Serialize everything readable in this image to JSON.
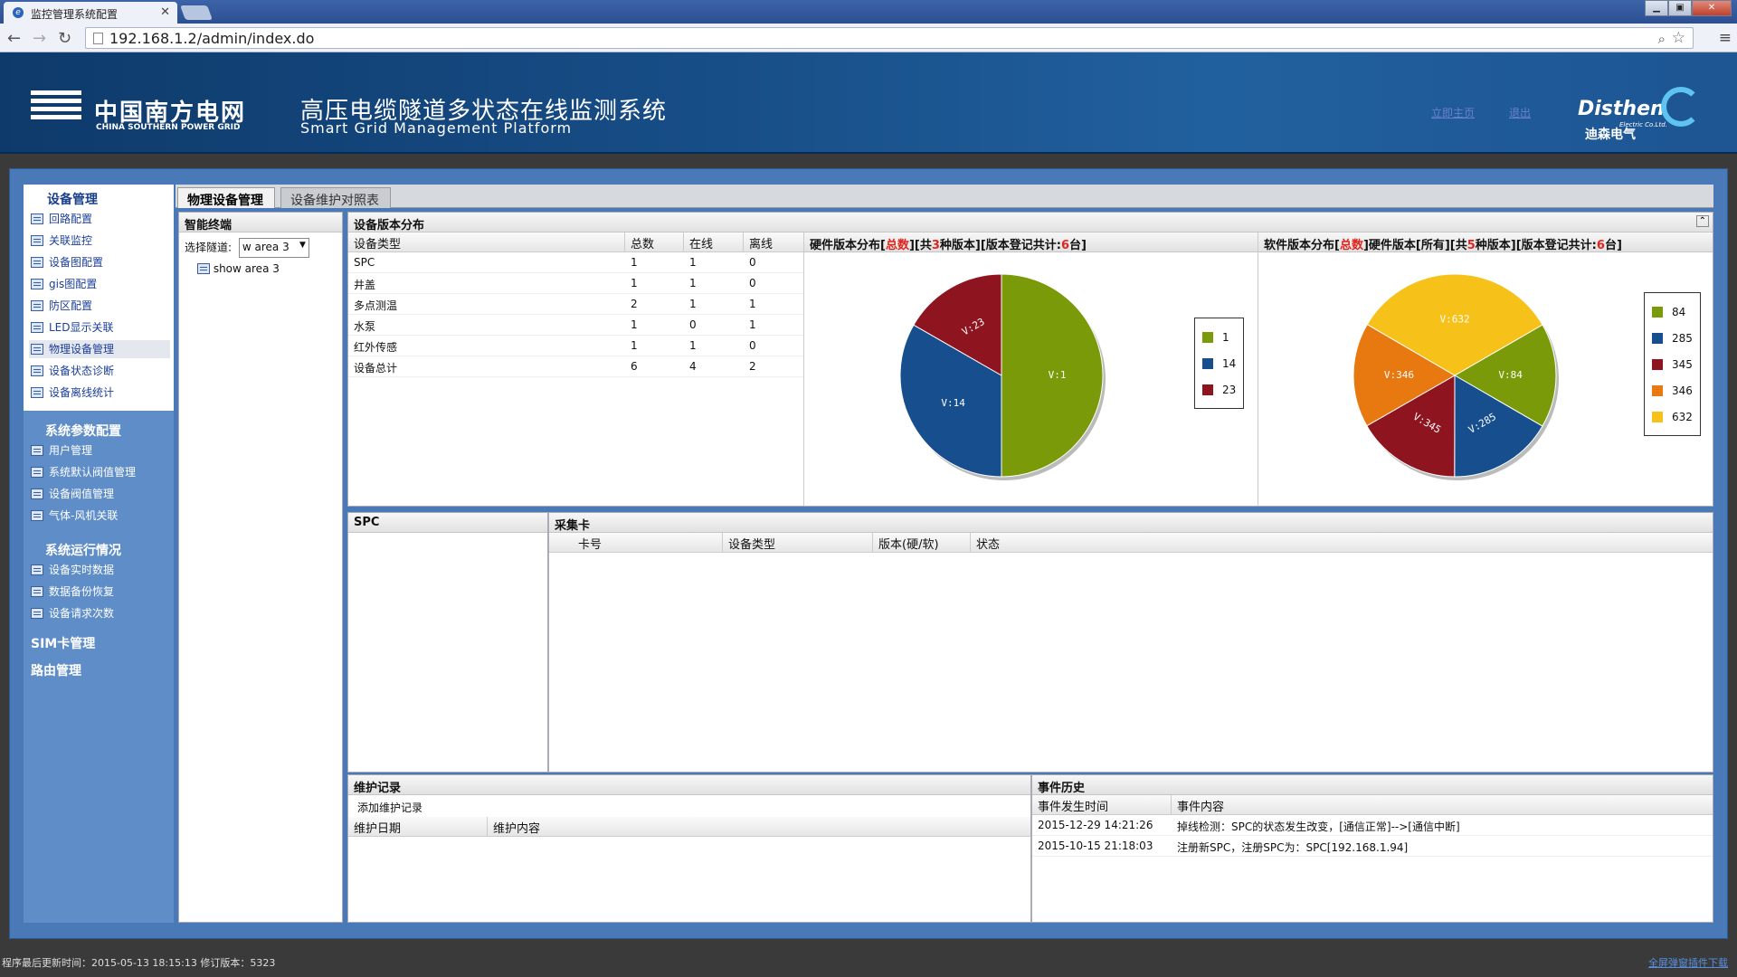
{
  "browser": {
    "tab_title": "监控管理系统配置",
    "url": "192.168.1.2/admin/index.do"
  },
  "header": {
    "logo_cn": "中国南方电网",
    "logo_en": "CHINA SOUTHERN POWER GRID",
    "title": "高压电缆隧道多状态在线监测系统",
    "subtitle": "Smart Grid Management Platform",
    "link_home": "立即主页",
    "link_logout": "退出",
    "brand_name": "Disthen",
    "brand_sub": "Electric Co.Ltd.",
    "brand_cn": "迪森电气"
  },
  "sidebar": {
    "group1": {
      "title": "设备管理",
      "items": [
        "回路配置",
        "关联监控",
        "设备图配置",
        "gis图配置",
        "防区配置",
        "LED显示关联",
        "物理设备管理",
        "设备状态诊断",
        "设备离线统计"
      ]
    },
    "group2": {
      "title": "系统参数配置",
      "items": [
        "用户管理",
        "系统默认阀值管理",
        "设备阀值管理",
        "气体-风机关联"
      ]
    },
    "group3": {
      "title": "系统运行情况",
      "items": [
        "设备实时数据",
        "数据备份恢复",
        "设备请求次数"
      ]
    },
    "group4_title": "SIM卡管理",
    "group5_title": "路由管理"
  },
  "tabs": [
    "物理设备管理",
    "设备维护对照表"
  ],
  "terminal": {
    "title": "智能终端",
    "select_label": "选择隧道:",
    "select_value": "w area 3",
    "tree_node": "show area 3"
  },
  "version": {
    "title": "设备版本分布",
    "columns": [
      "设备类型",
      "总数",
      "在线",
      "离线"
    ],
    "rows": [
      [
        "SPC",
        "1",
        "1",
        "0"
      ],
      [
        "井盖",
        "1",
        "1",
        "0"
      ],
      [
        "多点测温",
        "2",
        "1",
        "1"
      ],
      [
        "水泵",
        "1",
        "0",
        "1"
      ],
      [
        "红外传感",
        "1",
        "1",
        "0"
      ],
      [
        "设备总计",
        "6",
        "4",
        "2"
      ]
    ]
  },
  "hw_chart": {
    "t1": "硬件版本分布[",
    "t2": "总数",
    "t3": "][共",
    "t4": "3",
    "t5": "种版本][版本登记共计:",
    "t6": "6",
    "t7": "台]",
    "slice_labels": [
      "V:1",
      "V:14",
      "V:23"
    ],
    "legend": [
      "1",
      "14",
      "23"
    ],
    "colors": [
      "#7a9a0a",
      "#174f8e",
      "#8e1520"
    ]
  },
  "sw_chart": {
    "t1": "软件版本分布[",
    "t2": "总数",
    "t3": "]硬件版本[所有][共",
    "t4": "5",
    "t5": "种版本][版本登记共计:",
    "t6": "6",
    "t7": "台]",
    "slice_labels": [
      "V:84",
      "V:285",
      "V:345",
      "V:346",
      "V:632"
    ],
    "legend": [
      "84",
      "285",
      "345",
      "346",
      "632"
    ],
    "colors": [
      "#7a9a0a",
      "#174f8e",
      "#8e1520",
      "#e87810",
      "#f6c21a"
    ]
  },
  "spc_panel": {
    "title": "SPC"
  },
  "card_panel": {
    "title": "采集卡",
    "columns": [
      "卡号",
      "设备类型",
      "版本(硬/软)",
      "状态"
    ]
  },
  "maintenance": {
    "title": "维护记录",
    "add_label": "添加维护记录",
    "columns": [
      "维护日期",
      "维护内容"
    ]
  },
  "events": {
    "title": "事件历史",
    "columns": [
      "事件发生时间",
      "事件内容"
    ],
    "rows": [
      [
        "2015-12-29 14:21:26",
        "掉线检测：SPC的状态发生改变，[通信正常]-->[通信中断]"
      ],
      [
        "2015-10-15 21:18:03",
        "注册新SPC，注册SPC为：SPC[192.168.1.94]"
      ]
    ]
  },
  "status": {
    "left": "程序最后更新时间：2015-05-13 18:15:13  修订版本：5323",
    "right": "全屏弹窗插件下载"
  },
  "chart_data": [
    {
      "type": "pie",
      "title": "硬件版本分布[总数][共3种版本][版本登记共计:6台]",
      "labels": [
        "1",
        "14",
        "23"
      ],
      "values": [
        0.5,
        0.333,
        0.167
      ]
    },
    {
      "type": "pie",
      "title": "软件版本分布[总数]硬件版本[所有][共5种版本][版本登记共计:6台]",
      "labels": [
        "84",
        "285",
        "345",
        "346",
        "632"
      ],
      "values": [
        0.167,
        0.167,
        0.167,
        0.167,
        0.333
      ]
    }
  ]
}
